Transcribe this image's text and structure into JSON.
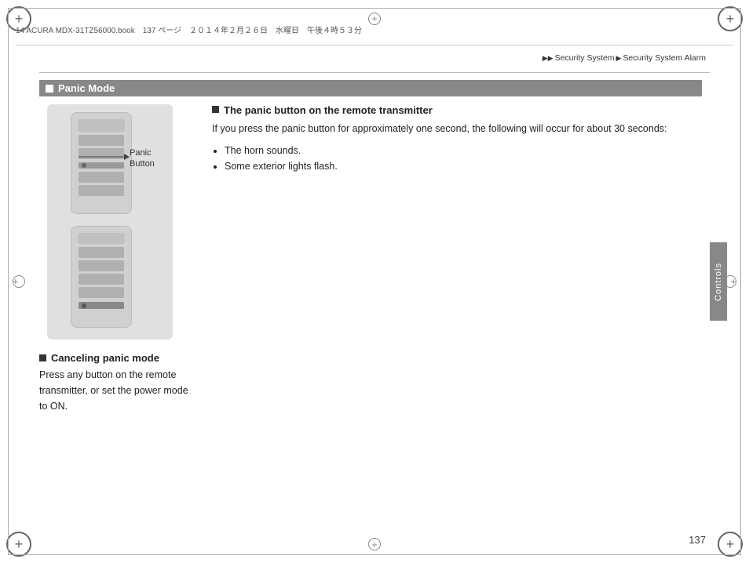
{
  "header": {
    "file_info": "14 ACURA MDX-31TZ56000.book　137 ページ　２０１４年２月２６日　水曜日　午後４時５３分",
    "breadcrumb": {
      "arrow1": "▶▶",
      "part1": "Security System",
      "arrow2": "▶",
      "part2": "Security System Alarm"
    }
  },
  "section": {
    "title": "Panic Mode",
    "left_label_line1": "Panic",
    "left_label_line2": "Button",
    "subsection1": {
      "title": "The panic button on the remote transmitter",
      "body": "If you press the panic button for approximately one second, the following will occur for about 30 seconds:",
      "bullets": [
        "The horn sounds.",
        "Some exterior lights flash."
      ]
    },
    "subsection2": {
      "title": "Canceling panic mode",
      "body": "Press any button on the remote transmitter, or set the power mode to ON."
    }
  },
  "side_tab": {
    "label": "Controls"
  },
  "page_number": "137"
}
